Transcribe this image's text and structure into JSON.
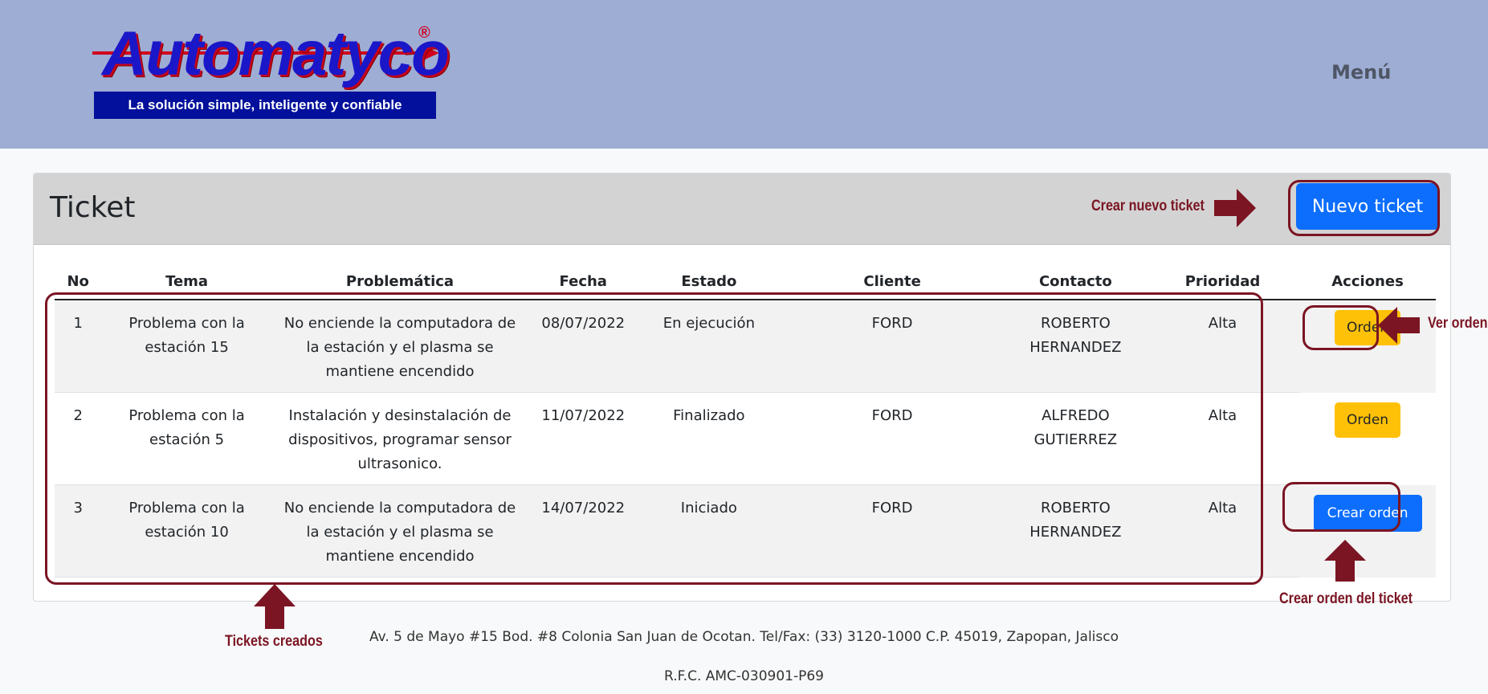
{
  "header": {
    "logo_text": "Automatyco",
    "logo_reg": "®",
    "logo_tagline": "La solución simple, inteligente y confiable",
    "menu_label": "Menú"
  },
  "card": {
    "title": "Ticket",
    "new_ticket_label": "Nuevo ticket"
  },
  "table": {
    "columns": [
      "No",
      "Tema",
      "Problemática",
      "Fecha",
      "Estado",
      "Cliente",
      "Contacto",
      "Prioridad",
      "Acciones"
    ],
    "rows": [
      {
        "no": "1",
        "tema": "Problema con la estación 15",
        "problematica": "No enciende la computadora de la estación y el plasma se mantiene encendido",
        "fecha": "08/07/2022",
        "estado": "En ejecución",
        "cliente": "FORD",
        "contacto": "ROBERTO HERNANDEZ",
        "prioridad": "Alta",
        "accion": "Orden"
      },
      {
        "no": "2",
        "tema": "Problema con la estación 5",
        "problematica": "Instalación y desinstalación de dispositivos, programar sensor ultrasonico.",
        "fecha": "11/07/2022",
        "estado": "Finalizado",
        "cliente": "FORD",
        "contacto": "ALFREDO GUTIERREZ",
        "prioridad": "Alta",
        "accion": "Orden"
      },
      {
        "no": "3",
        "tema": "Problema con la estación 10",
        "problematica": "No enciende la computadora de la estación y el plasma se mantiene encendido",
        "fecha": "14/07/2022",
        "estado": "Iniciado",
        "cliente": "FORD",
        "contacto": "ROBERTO HERNANDEZ",
        "prioridad": "Alta",
        "accion": "Crear orden"
      }
    ]
  },
  "annotations": {
    "crear_nuevo_ticket": "Crear nuevo ticket",
    "ver_orden": "Ver orden",
    "tickets_creados": "Tickets creados",
    "crear_orden_ticket": "Crear orden del ticket",
    "color": "#7b1523"
  },
  "footer": {
    "address": "Av. 5 de Mayo #15 Bod. #8 Colonia San Juan de Ocotan. Tel/Fax: (33) 3120-1000 C.P. 45019, Zapopan, Jalisco",
    "rfc": "R.F.C. AMC-030901-P69"
  },
  "colors": {
    "header_bg": "#9eadd4",
    "primary": "#0d6efd",
    "warning": "#ffc107",
    "logo_blue": "#1a17c9",
    "logo_red": "#d0001d",
    "tagline_bg": "#02109b"
  }
}
